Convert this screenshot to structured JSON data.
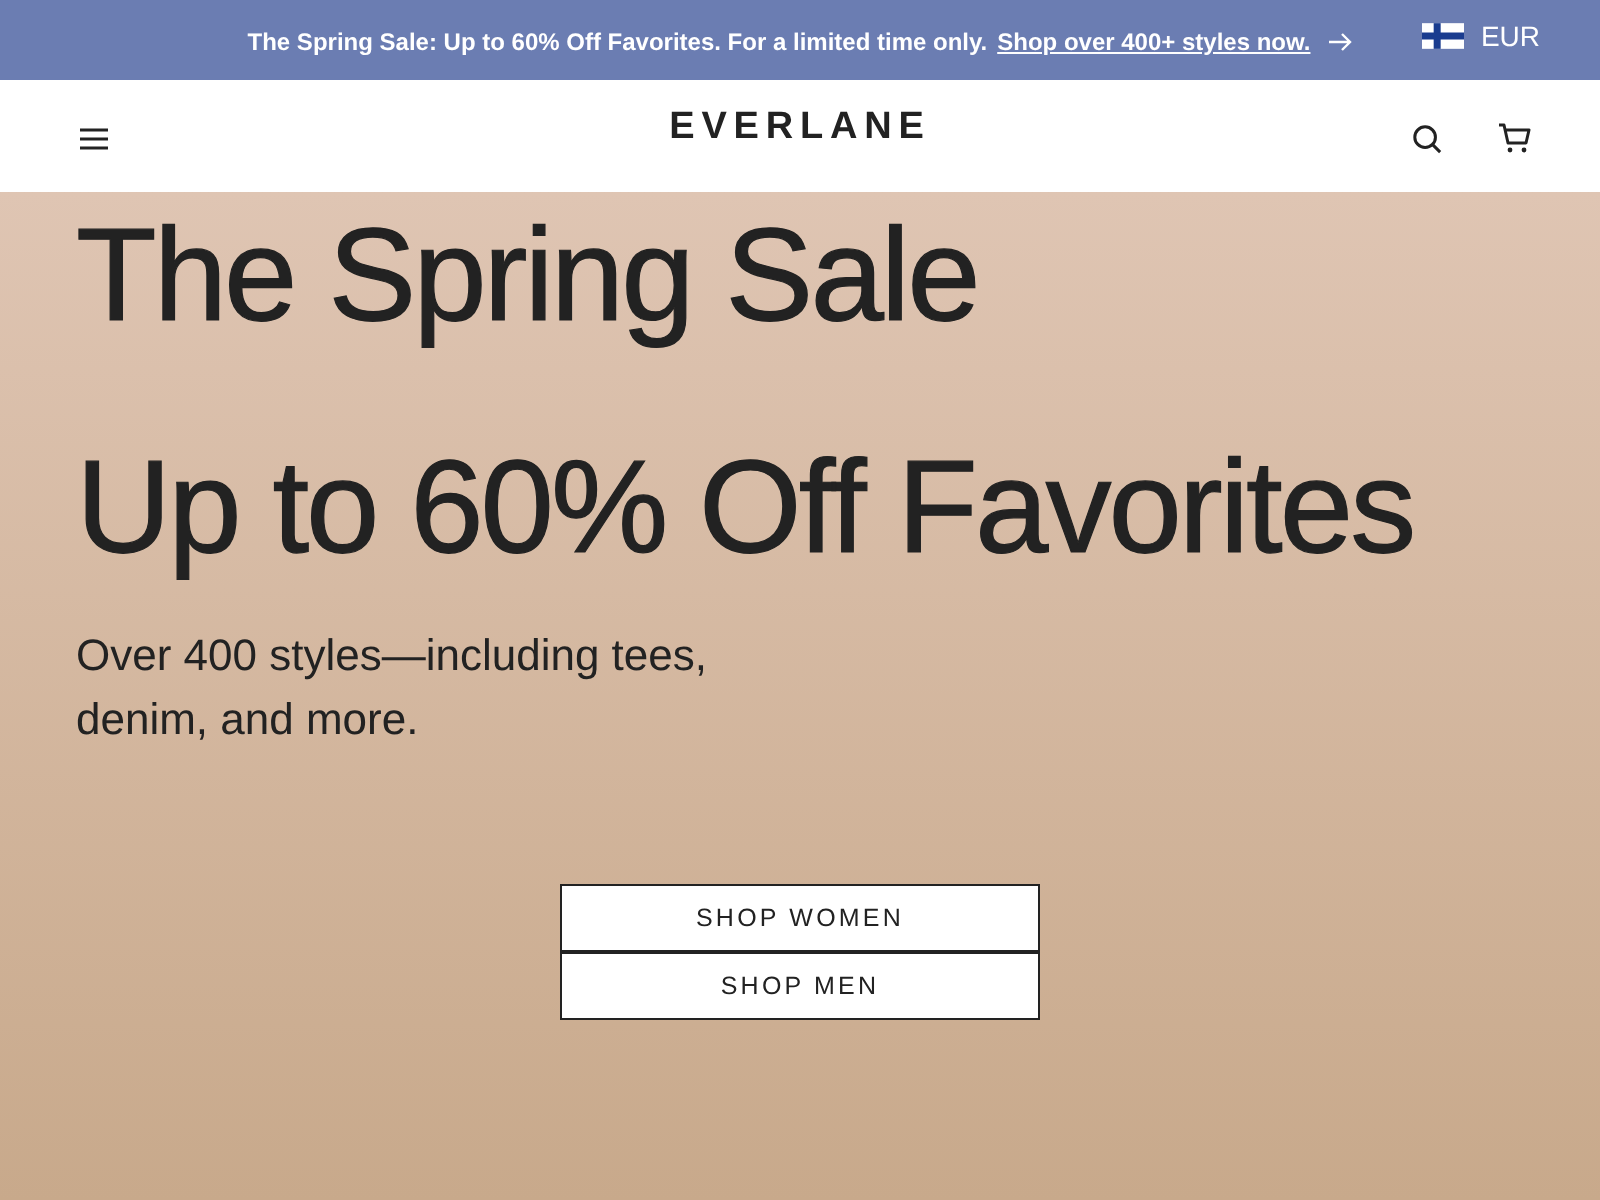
{
  "announcement": {
    "text": "The Spring Sale: Up to 60% Off Favorites. For a limited time only.",
    "link": "Shop over 400+ styles now.",
    "currency": "EUR"
  },
  "header": {
    "logo": "EVERLANE"
  },
  "hero": {
    "title": "The Spring Sale",
    "headline": "Up to 60% Off Favorites",
    "subtitle": "Over 400 styles—including tees, denim, and more.",
    "buttons": [
      "SHOP WOMEN",
      "SHOP MEN"
    ]
  }
}
